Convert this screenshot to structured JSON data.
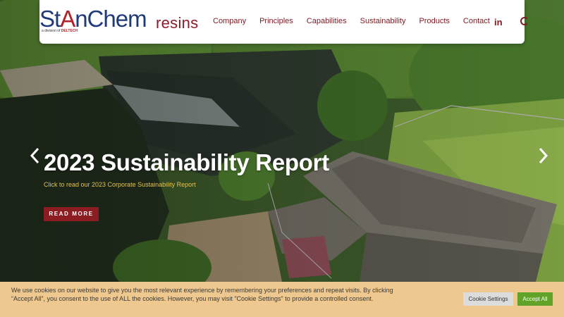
{
  "brand": {
    "logo_pre": "St",
    "logo_a": "A",
    "logo_post": "nChem",
    "logo_suffix": "resins",
    "tagline_pre": "a division of",
    "tagline_brand": "DELTECH"
  },
  "nav": {
    "items": [
      {
        "label": "Company"
      },
      {
        "label": "Principles"
      },
      {
        "label": "Capabilities"
      },
      {
        "label": "Sustainability"
      },
      {
        "label": "Products"
      },
      {
        "label": "Contact"
      }
    ],
    "linkedin_label": "in"
  },
  "slide": {
    "title": "2023 Sustainability Report",
    "subtitle": "Click to read our 2023 Corporate Sustainability Report",
    "cta_label": "READ MORE"
  },
  "cookie": {
    "text": "We use cookies on our website to give you the most relevant experience by remembering your preferences and repeat visits. By clicking “Accept All”, you consent to the use of ALL the cookies. However, you may visit \"Cookie Settings\" to provide a controlled consent.",
    "settings_label": "Cookie Settings",
    "accept_label": "Accept All"
  },
  "colors": {
    "brand_blue": "#1f3a7a",
    "brand_red": "#8b1c22",
    "subtitle_gold": "#e7c14a",
    "cookie_bg": "#eec88e",
    "accept_green": "#61a229"
  },
  "icons": {
    "left_arrow": "chevron-left-icon",
    "right_arrow": "chevron-right-icon",
    "search": "search-icon",
    "linkedin": "linkedin-icon"
  }
}
